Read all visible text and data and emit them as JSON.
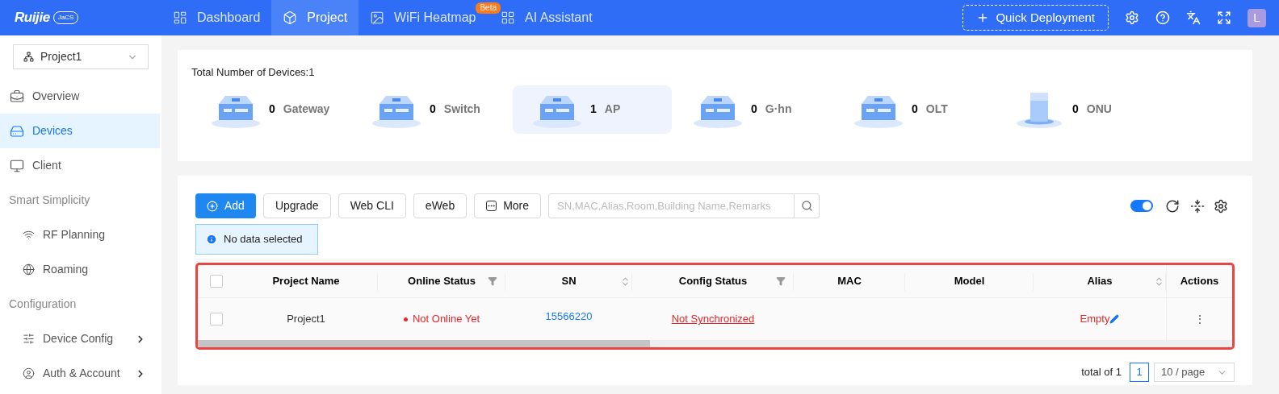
{
  "header": {
    "logo": "Ruijie",
    "logo_badge": "JaCS",
    "nav": [
      {
        "label": "Dashboard",
        "selected": false
      },
      {
        "label": "Project",
        "selected": true
      },
      {
        "label": "WiFi Heatmap",
        "selected": false,
        "badge": "Beta"
      },
      {
        "label": "AI Assistant",
        "selected": false
      }
    ],
    "quick_deployment": "Quick Deployment",
    "avatar": "L"
  },
  "sidebar": {
    "project": "Project1",
    "items": [
      {
        "kind": "item",
        "label": "Overview",
        "selected": false
      },
      {
        "kind": "item",
        "label": "Devices",
        "selected": true
      },
      {
        "kind": "item",
        "label": "Client",
        "selected": false
      },
      {
        "kind": "section",
        "label": "Smart Simplicity"
      },
      {
        "kind": "subitem",
        "label": "RF Planning",
        "selected": false,
        "expandable": false
      },
      {
        "kind": "subitem",
        "label": "Roaming",
        "selected": false,
        "expandable": false
      },
      {
        "kind": "section",
        "label": "Configuration"
      },
      {
        "kind": "subitem",
        "label": "Device Config",
        "selected": false,
        "expandable": true
      },
      {
        "kind": "subitem",
        "label": "Auth & Account",
        "selected": false,
        "expandable": true
      }
    ]
  },
  "summary": {
    "title": "Total Number of Devices:1",
    "device_types": [
      {
        "count": "0",
        "label": "Gateway",
        "kind": "rack",
        "selected": false
      },
      {
        "count": "0",
        "label": "Switch",
        "kind": "rack",
        "selected": false
      },
      {
        "count": "1",
        "label": "AP",
        "kind": "rack",
        "selected": true
      },
      {
        "count": "0",
        "label": "G·hn",
        "kind": "rack",
        "selected": false
      },
      {
        "count": "0",
        "label": "OLT",
        "kind": "rack",
        "selected": false
      },
      {
        "count": "0",
        "label": "ONU",
        "kind": "tower",
        "selected": false
      }
    ]
  },
  "toolbar": {
    "buttons": [
      {
        "label": "Add",
        "kind": "primary"
      },
      {
        "label": "Upgrade",
        "kind": "default"
      },
      {
        "label": "Web CLI",
        "kind": "default"
      },
      {
        "label": "eWeb",
        "kind": "default"
      },
      {
        "label": "More",
        "kind": "more"
      }
    ],
    "search_placeholder": "SN,MAC,Alias,Room,Building Name,Remarks",
    "toggle_on": true
  },
  "selection_notice": "No data selected",
  "table": {
    "all_checked": false,
    "columns": [
      {
        "label": "Project Name",
        "kind": "plain"
      },
      {
        "label": "Online Status",
        "kind": "filter"
      },
      {
        "label": "SN",
        "kind": "sort"
      },
      {
        "label": "Config Status",
        "kind": "filter"
      },
      {
        "label": "MAC",
        "kind": "plain"
      },
      {
        "label": "Model",
        "kind": "plain"
      },
      {
        "label": "Alias",
        "kind": "sort"
      },
      {
        "label": "Actions",
        "kind": "plain"
      }
    ],
    "rows": [
      {
        "checked": false,
        "project_name": "Project1",
        "online_status": "Not Online Yet",
        "online": false,
        "sn": "15566220",
        "config_status": "Not Synchronized",
        "alias": "Empty",
        "actions": "⋮"
      }
    ]
  },
  "pagination": {
    "total": "total of 1",
    "pages": [
      {
        "label": "1",
        "selected": true
      }
    ],
    "page_size": "10 / page"
  }
}
